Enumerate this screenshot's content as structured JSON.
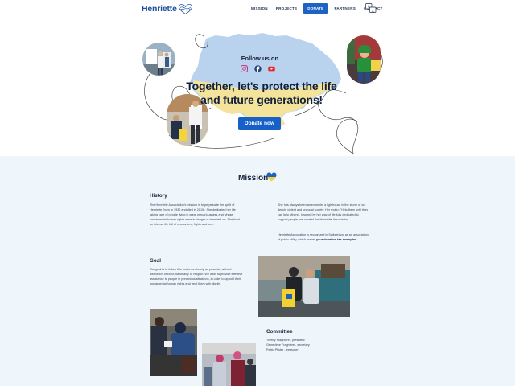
{
  "header": {
    "logo_text": "Henriette",
    "nav": [
      "MISSION",
      "PROJECTS",
      "DONATE",
      "PARTNERS",
      "CONTACT"
    ],
    "active_nav": "DONATE"
  },
  "hero": {
    "follow_label": "Follow us on",
    "title": "Together, let's protect the life and future generations!",
    "donate_label": "Donate now"
  },
  "mission": {
    "title": "Mission",
    "history": {
      "heading": "History",
      "left_text": "The Henriette Association's mission is to perpetuate the spirit of Henriette (born in 1932 and died in 2019). She dedicated her life taking care of people living in great precariousness and whose fundamental human rights were in danger or trampled on. She lived an intense life full of encounters, fights and love.",
      "right_text_1": "She has always been an example, a lighthouse in the storm of our deeply violent and unequal society. Her motto: \"Help them until they can help others\". Inspired by her way of life fully dedicated to support people, we created the Henriette Association.",
      "right_text_2": "Henriette Association is recognized in Switzerland as an association of public utility, which makes",
      "right_text_bold": "your donation tax-exempted",
      "right_text_end": "."
    },
    "goal": {
      "heading": "Goal",
      "text": "Our goal is to follow this motto as closely as possible, without distinction of color, nationality or religion. We want to provide effective assistance to people in precarious situations, in order to uphold their fundamental human rights and treat them with dignity."
    },
    "committee": {
      "heading": "Committee",
      "members": [
        "Thierry Fragnière - president",
        "Geneviève Fragnière - secretary",
        "Pablo Pfister - treasurer"
      ]
    }
  },
  "colors": {
    "brand_blue": "#1c63c2",
    "ukraine_blue": "#b9d3ee",
    "ukraine_yellow": "#f4e39a",
    "mission_bg": "#eef5fb"
  },
  "icons": [
    "heart-logo-icon",
    "language-icon",
    "instagram-icon",
    "facebook-icon",
    "youtube-icon",
    "heart-icon"
  ]
}
